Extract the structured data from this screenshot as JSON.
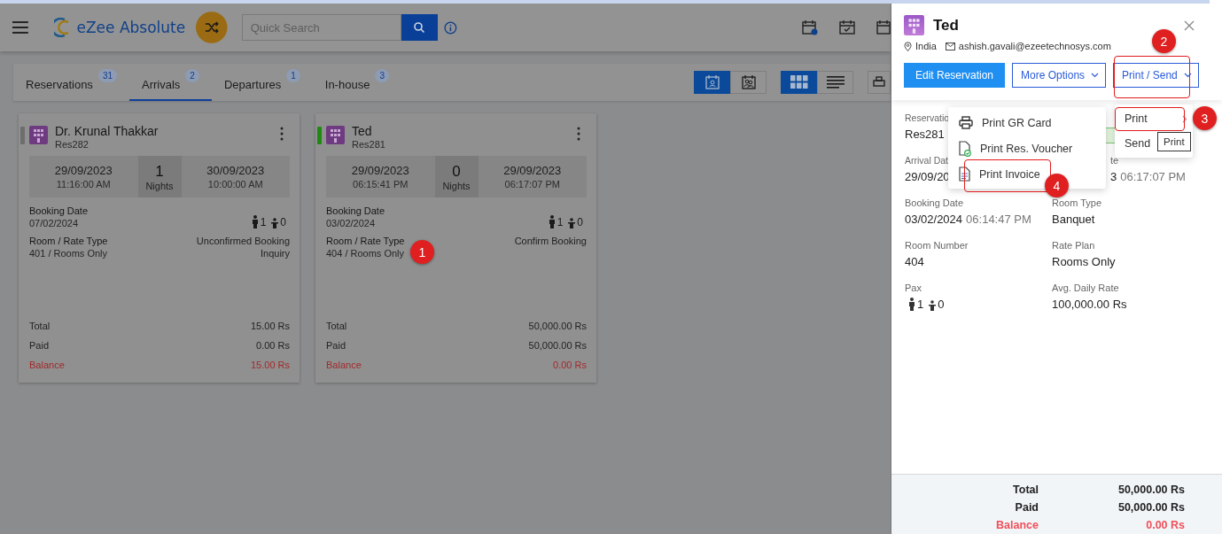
{
  "header": {
    "logo_text": "eZee Absolute",
    "search": {
      "placeholder": "Quick Search"
    }
  },
  "tabs": [
    {
      "label": "Reservations",
      "count": "31",
      "selected": false
    },
    {
      "label": "Arrivals",
      "count": "2",
      "selected": true
    },
    {
      "label": "Departures",
      "count": "1",
      "selected": false
    },
    {
      "label": "In-house",
      "count": "3",
      "selected": false
    }
  ],
  "calendar_views": [
    {
      "selected": true
    },
    {
      "selected": false
    }
  ],
  "layout_views": [
    {
      "selected": true
    },
    {
      "selected": false
    }
  ],
  "cards": [
    {
      "name": "Dr. Krunal Thakkar",
      "reservation_no": "Res282",
      "color": "#6e6e6e",
      "arrival_date": "29/09/2023",
      "arrival_time": "11:16:00 AM",
      "nights": "1",
      "nights_label": "Nights",
      "departure_date": "30/09/2023",
      "departure_time": "10:00:00 AM",
      "booking_label": "Booking Date",
      "booking_date": "07/02/2024",
      "adults": "1",
      "children": "0",
      "room_label": "Room / Rate Type",
      "room_rate": "401 / Rooms Only",
      "status_lines": [
        "Unconfirmed Booking",
        "Inquiry"
      ],
      "totals": [
        {
          "label": "Total",
          "value": "15.00 Rs",
          "kind": "normal"
        },
        {
          "label": "Paid",
          "value": "0.00 Rs",
          "kind": "normal"
        },
        {
          "label": "Balance",
          "value": "15.00 Rs",
          "kind": "balance"
        }
      ]
    },
    {
      "name": "Ted",
      "reservation_no": "Res281",
      "color": "#1f8a12",
      "arrival_date": "29/09/2023",
      "arrival_time": "06:15:41 PM",
      "nights": "0",
      "nights_label": "Nights",
      "departure_date": "29/09/2023",
      "departure_time": "06:17:07 PM",
      "booking_label": "Booking Date",
      "booking_date": "03/02/2024",
      "adults": "1",
      "children": "0",
      "room_label": "Room / Rate Type",
      "room_rate": "404 / Rooms Only",
      "status_lines": [
        "Confirm Booking"
      ],
      "totals": [
        {
          "label": "Total",
          "value": "50,000.00 Rs",
          "kind": "normal"
        },
        {
          "label": "Paid",
          "value": "50,000.00 Rs",
          "kind": "normal"
        },
        {
          "label": "Balance",
          "value": "0.00 Rs",
          "kind": "balance"
        }
      ]
    }
  ],
  "panel": {
    "title": "Ted",
    "location": "India",
    "email": "ashish.gavali@ezeetechnosys.com",
    "buttons": [
      {
        "label": "Edit Reservation",
        "kind": "primary"
      },
      {
        "label": "More Options",
        "kind": "dropdown"
      },
      {
        "label": "Print / Send",
        "kind": "dropdown"
      }
    ],
    "details": [
      [
        {
          "kind": "text",
          "label": "Reservatio",
          "value": "Res281"
        },
        {
          "kind": "badge"
        }
      ],
      [
        {
          "kind": "text",
          "label": "Arrival Dat",
          "value": "29/09/20"
        },
        {
          "kind": "clipped",
          "label": "te",
          "value": "3",
          "time": "06:17:07 PM"
        }
      ],
      [
        {
          "kind": "text",
          "label": "Booking Date",
          "value": "03/02/2024",
          "time": "06:14:47 PM"
        },
        {
          "kind": "text",
          "label": "Room Type",
          "value": "Banquet"
        }
      ],
      [
        {
          "kind": "text",
          "label": "Room Number",
          "value": "404"
        },
        {
          "kind": "text",
          "label": "Rate Plan",
          "value": "Rooms Only"
        }
      ],
      [
        {
          "kind": "pax",
          "label": "Pax",
          "adults": "1",
          "children": "0"
        },
        {
          "kind": "text",
          "label": "Avg. Daily Rate",
          "value": "100,000.00 Rs"
        }
      ]
    ],
    "totals": [
      {
        "label": "Total",
        "value": "50,000.00 Rs",
        "kind": "normal"
      },
      {
        "label": "Paid",
        "value": "50,000.00 Rs",
        "kind": "normal"
      },
      {
        "label": "Balance",
        "value": "0.00 Rs",
        "kind": "balance"
      }
    ]
  },
  "print_send_menu": {
    "items": [
      {
        "label": "Print",
        "kind": "submenu"
      },
      {
        "label": "Send",
        "kind": "action"
      }
    ],
    "tooltip": "Print"
  },
  "print_submenu": {
    "items": [
      {
        "label": "Print GR Card"
      },
      {
        "label": "Print Res. Voucher"
      },
      {
        "label": "Print Invoice"
      }
    ]
  },
  "annotations": [
    {
      "label": "1"
    },
    {
      "label": "2"
    },
    {
      "label": "3"
    },
    {
      "label": "4"
    }
  ]
}
